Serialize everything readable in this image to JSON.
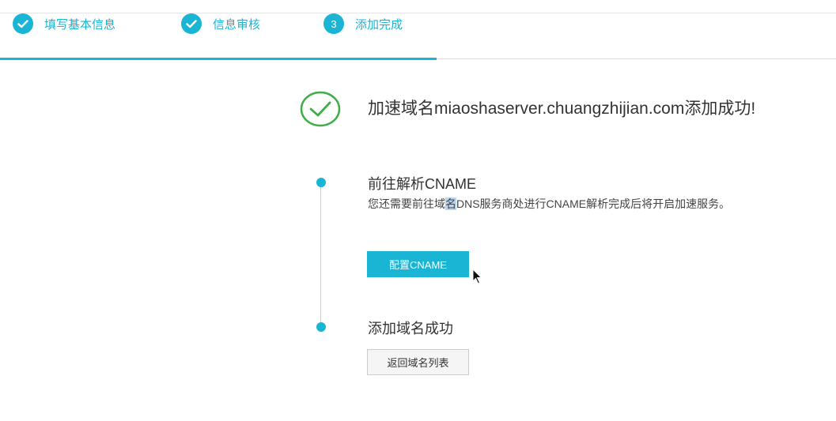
{
  "steps": [
    {
      "icon": "check-icon",
      "mark": "",
      "label": "填写基本信息"
    },
    {
      "icon": "check-icon",
      "mark": "",
      "label": "信息审核"
    },
    {
      "icon": "number-icon",
      "mark": "3",
      "label": "添加完成"
    }
  ],
  "result": {
    "icon": "success-check-circle-icon",
    "title": "加速域名miaoshaserver.chuangzhijian.com添加成功!"
  },
  "cname_section": {
    "title": "前往解析CNAME",
    "desc_before": "您还需要前往域",
    "desc_selected": "名",
    "desc_after": "DNS服务商处进行CNAME解析完成后将开启加速服务。",
    "button_label": "配置CNAME"
  },
  "done_section": {
    "title": "添加域名成功",
    "button_label": "返回域名列表"
  },
  "colors": {
    "accent": "#1ab4d4",
    "success": "#3fae49",
    "selection": "#b8d6f2"
  }
}
